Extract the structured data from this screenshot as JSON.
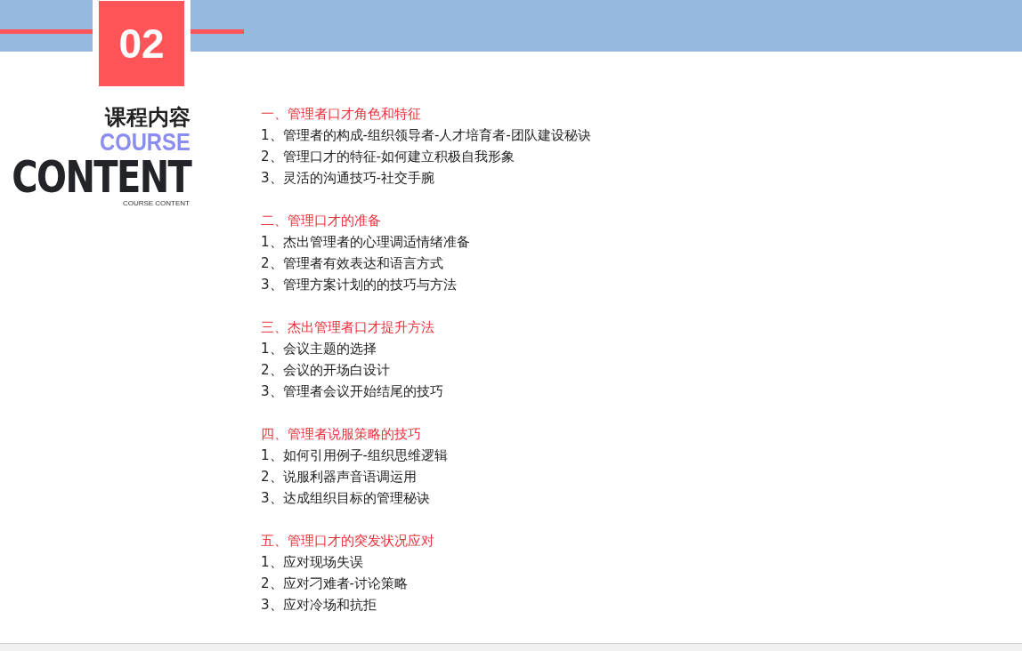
{
  "badge": "02",
  "title": {
    "chinese": "课程内容",
    "english_top": "COURSE",
    "english_big": "CONTENT",
    "english_small": "COURSE CONTENT"
  },
  "sections": [
    {
      "heading": "一、管理者口才角色和特征",
      "items": [
        "1、管理者的构成-组织领导者-人才培育者-团队建设秘诀",
        "2、管理口才的特征-如何建立积极自我形象",
        "3、灵活的沟通技巧-社交手腕"
      ]
    },
    {
      "heading": "二、管理口才的准备",
      "items": [
        "1、杰出管理者的心理调适情绪准备",
        "2、管理者有效表达和语言方式",
        "3、管理方案计划的的技巧与方法"
      ]
    },
    {
      "heading": "三、杰出管理者口才提升方法",
      "items": [
        "1、会议主题的选择",
        "2、会议的开场白设计",
        "3、管理者会议开始结尾的技巧"
      ]
    },
    {
      "heading": "四、管理者说服策略的技巧",
      "items": [
        "1、如何引用例子-组织思维逻辑",
        "2、说服利器声音语调运用",
        "3、达成组织目标的管理秘诀"
      ]
    },
    {
      "heading": "五、管理口才的突发状况应对",
      "items": [
        "1、应对现场失误",
        "2、应对刁难者-讨论策略",
        "3、应对冷场和抗拒"
      ]
    }
  ]
}
